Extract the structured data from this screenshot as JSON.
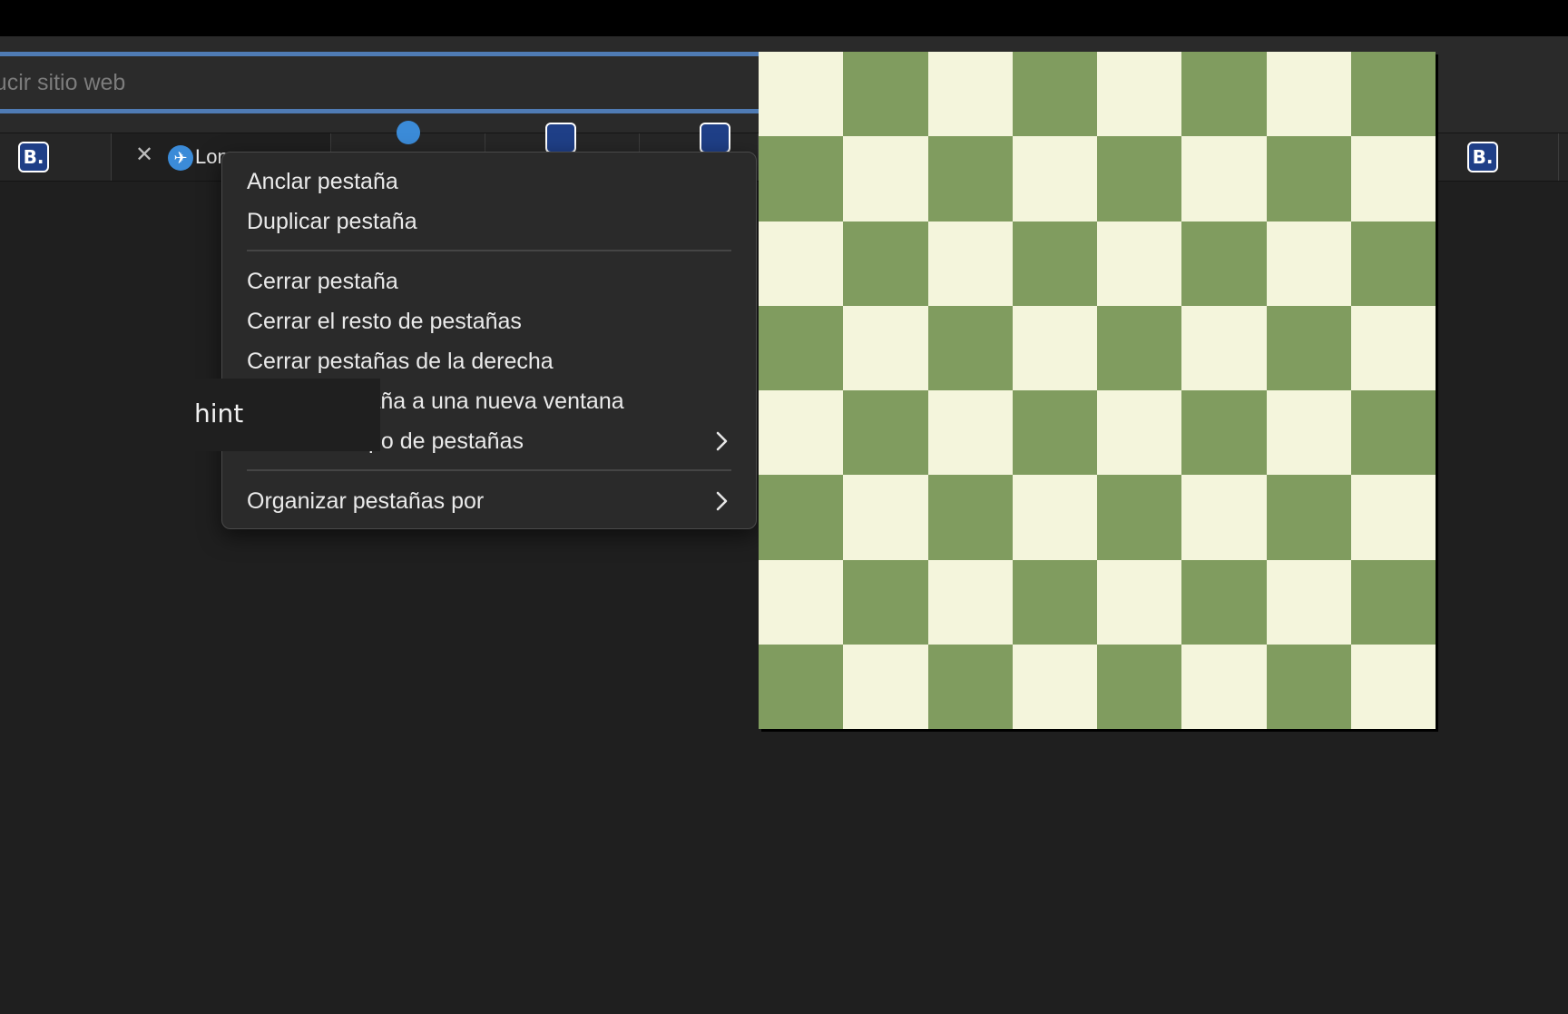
{
  "browser": {
    "url_bar": {
      "text": "oducir sitio web"
    },
    "tabs": [
      {
        "kind": "booking",
        "icon": "B."
      },
      {
        "kind": "active",
        "title": "Lon",
        "icon": "plane-icon"
      },
      {
        "kind": "partial-blue-dot"
      },
      {
        "kind": "booking-partial",
        "icon": "B."
      },
      {
        "kind": "booking-partial",
        "icon": "B."
      },
      {
        "kind": "booking",
        "icon": "B."
      }
    ]
  },
  "context_menu": {
    "items": [
      {
        "label": "Anclar pestaña"
      },
      {
        "label": "Duplicar pestaña"
      },
      {
        "label": "Cerrar pestaña"
      },
      {
        "label": "Cerrar el resto de pestañas"
      },
      {
        "label": "Cerrar pestañas de la derecha"
      },
      {
        "label": "stаña a una nueva ventana"
      },
      {
        "label": "po de pestañas",
        "submenu": true
      },
      {
        "label": "Organizar pestañas por",
        "submenu": true
      }
    ]
  },
  "hint": {
    "text": "hint"
  },
  "chessboard": {
    "rows": 8,
    "cols": 8,
    "light_color": "#f4f5dc",
    "dark_color": "#809c5f"
  }
}
